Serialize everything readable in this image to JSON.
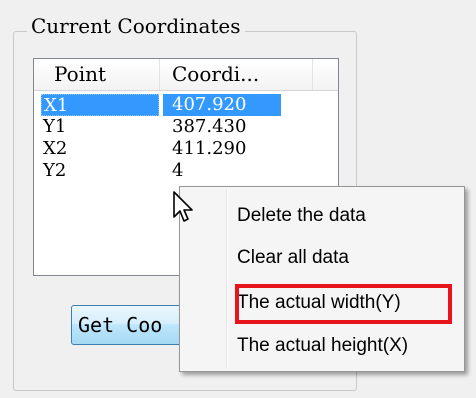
{
  "group": {
    "title": "Current Coordinates"
  },
  "list": {
    "columns": [
      "Point",
      "Coordi..."
    ],
    "rows": [
      {
        "point": "X1",
        "value": "407.920",
        "selected": true
      },
      {
        "point": "Y1",
        "value": "387.430",
        "selected": false
      },
      {
        "point": "X2",
        "value": "411.290",
        "selected": false
      },
      {
        "point": "Y2",
        "value": "4",
        "selected": false
      }
    ]
  },
  "buttons": {
    "get_coordinates_label": "Get Coo"
  },
  "context_menu": {
    "items": [
      "Delete the data",
      "Clear all data",
      "The actual width(Y)",
      "The actual height(X)"
    ],
    "highlighted_item_color": "#e8141b"
  },
  "icons": {
    "cursor": "arrow-pointer-icon"
  },
  "colors": {
    "selection": "#3399ff",
    "background": "#f0f0f0"
  }
}
